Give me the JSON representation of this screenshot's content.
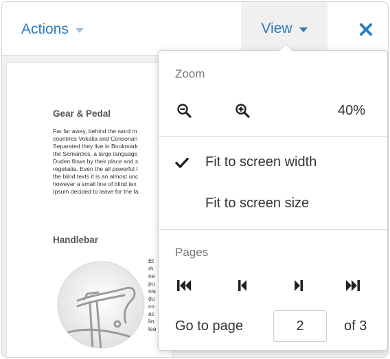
{
  "toolbar": {
    "actions_label": "Actions",
    "view_label": "View"
  },
  "document": {
    "section1_title": "Gear & Pedal",
    "section1_lines": [
      "Far far away, behind the word m",
      "countries Vokalia and Consonan",
      "Separated they live in Bookmark",
      "the Semantics, a large language",
      "Duden flows by their place and s",
      "regelialia. Even the all powerful I",
      "the blind texts it is an almost unc",
      "however a small line of blind tex",
      "Ipsum decided to leave for the fa"
    ],
    "section2_title": "Handlebar",
    "section2_lines": [
      "Et",
      "rh",
      "ne",
      "pu",
      "nis",
      "du",
      "co",
      "ac",
      "lin",
      "lea"
    ]
  },
  "menu": {
    "zoom_label": "Zoom",
    "zoom_level": "40%",
    "fit_width_label": "Fit to screen width",
    "fit_size_label": "Fit to screen size",
    "pages_label": "Pages",
    "goto_label": "Go to page",
    "current_page": "2",
    "of_label": "of 3"
  },
  "colors": {
    "accent": "#2a7bbf",
    "text": "#333333",
    "muted": "#777777"
  },
  "icons": {
    "zoom_out": "zoom-out-icon",
    "zoom_in": "zoom-in-icon",
    "check": "checkmark-icon",
    "first": "first-page-icon",
    "prev": "previous-page-icon",
    "next": "next-page-icon",
    "last": "last-page-icon",
    "close": "close-icon"
  }
}
